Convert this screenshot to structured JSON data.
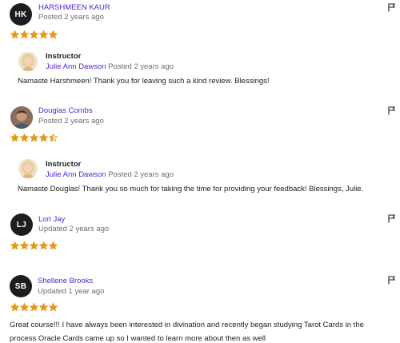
{
  "reviews": [
    {
      "initials": "HK",
      "name": "HARSHMEEN KAUR",
      "meta": "Posted 2 years ago",
      "rating": 5,
      "reply": {
        "role": "Instructor",
        "name": "Julie Ann Dawson",
        "date": "Posted 2 years ago",
        "text": "Namaste Harshmeen! Thank you for leaving such a kind review. Blessings!"
      }
    },
    {
      "initials": "",
      "name": "Douglas Combs",
      "meta": "Posted 2 years ago",
      "rating": 4.5,
      "reply": {
        "role": "Instructor",
        "name": "Julie Ann Dawson",
        "date": "Posted 2 years ago",
        "text": "Namaste Douglas! Thank you so much for taking the time for providing your feedback! Blessings, Julie."
      }
    },
    {
      "initials": "LJ",
      "name": "Lori Jay",
      "meta": "Updated 2 years ago",
      "rating": 5
    },
    {
      "initials": "SB",
      "name": "Shellene Brooks",
      "meta": "Updated 1 year ago",
      "rating": 5,
      "text": "Great course!!! I have always been interested in divination and recently began studying Tarot Cards in the process Oracle Cards came up so I wanted to learn more about then as well"
    }
  ],
  "colors": {
    "star": "#e59819",
    "link": "#5624d0",
    "muted": "#6a6f73",
    "avatar_bg": "#1c1d1f"
  },
  "icons": {
    "star": "star-icon",
    "half_star": "half-star-icon",
    "flag": "flag-icon"
  }
}
